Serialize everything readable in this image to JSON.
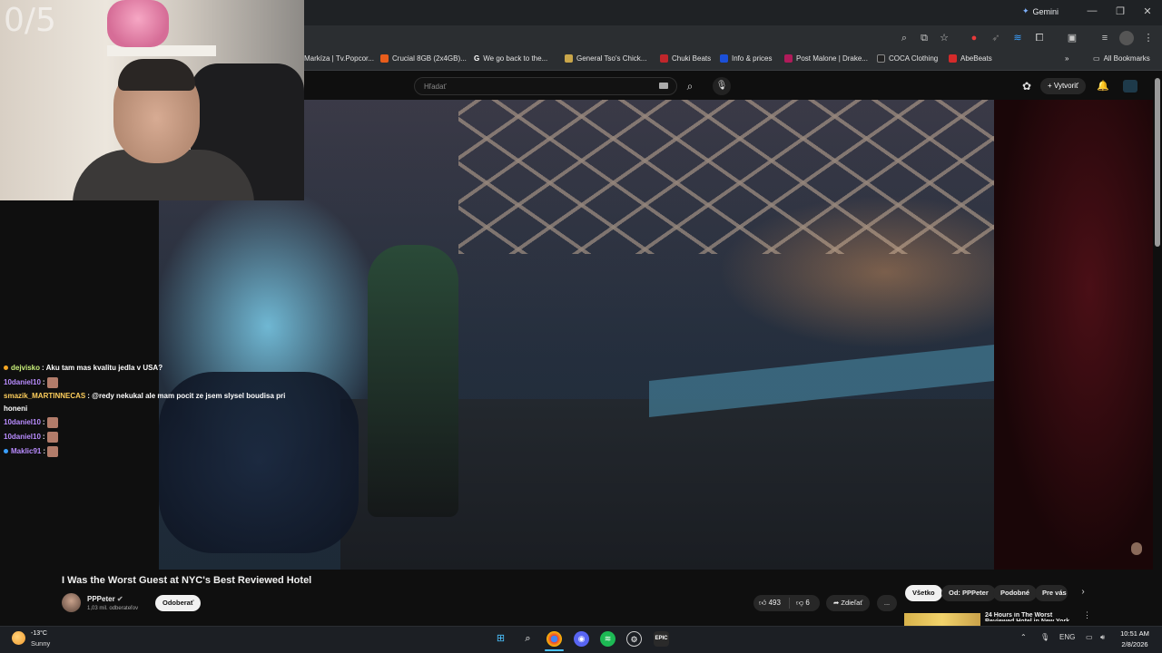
{
  "browser": {
    "gemini_label": "Gemini",
    "bookmarks": [
      {
        "label": "Markíza | Tv.Popcor...",
        "color": "#ffffff"
      },
      {
        "label": "Crucial 8GB (2x4GB)...",
        "color": "#e85d1b"
      },
      {
        "label": "We go back to the...",
        "color": "#ffffff"
      },
      {
        "label": "General Tso's Chick...",
        "color": "#c9a64a"
      },
      {
        "label": "Chuki Beats",
        "color": "#c0262b"
      },
      {
        "label": "Info & prices",
        "color": "#1b4fd8"
      },
      {
        "label": "Post Malone | Drake...",
        "color": "#b01b5a"
      },
      {
        "label": "COCA Clothing",
        "color": "#222222"
      },
      {
        "label": "AbeBeats",
        "color": "#d42a2a"
      }
    ],
    "all_bookmarks": "All Bookmarks"
  },
  "youtube": {
    "search_placeholder": "Hľadať",
    "create_label": "Vytvoriť",
    "video_title": "I Was the Worst Guest at NYC's Best Reviewed Hotel",
    "channel_name": "PPPeter",
    "subscribers": "1,03 mil. odberateľov",
    "subscribe_label": "Odoberať",
    "likes": "493",
    "dislikes": "6",
    "share_label": "Zdieľať",
    "more_label": "...",
    "chips": [
      "Všetko",
      "Od: PPPeter",
      "Podobné",
      "Pre vás"
    ],
    "rec_title": "24 Hours in The Worst Reviewed Hotel in New York"
  },
  "stream": {
    "score": "0/5",
    "chat": [
      {
        "user": "dejvisko",
        "color": "#c9f07a",
        "dot": "#f5a623",
        "message": ": Aku tam mas kvalitu jedla v USA?",
        "emote": false
      },
      {
        "user": "10daniel10",
        "color": "#b98cff",
        "dot": "",
        "message": ": ",
        "emote": true
      },
      {
        "user": "smazik_MARTINNECAS",
        "color": "#ffcf5c",
        "dot": "",
        "message": ": @redy nekukal ale mam pocit ze jsem slysel boudisa pri",
        "emote": false
      },
      {
        "user": "",
        "color": "#ffffff",
        "dot": "",
        "message": "honeni",
        "emote": false
      },
      {
        "user": "10daniel10",
        "color": "#b98cff",
        "dot": "",
        "message": ": ",
        "emote": true
      },
      {
        "user": "10daniel10",
        "color": "#b98cff",
        "dot": "",
        "message": ": ",
        "emote": true
      },
      {
        "user": "Maklic91",
        "color": "#b98cff",
        "dot": "#3aa0ff",
        "message": ": ",
        "emote": true
      }
    ]
  },
  "taskbar": {
    "temp": "-13°C",
    "weather": "Sunny",
    "lang": "ENG",
    "time": "10:51 AM",
    "date": "2/8/2026"
  }
}
